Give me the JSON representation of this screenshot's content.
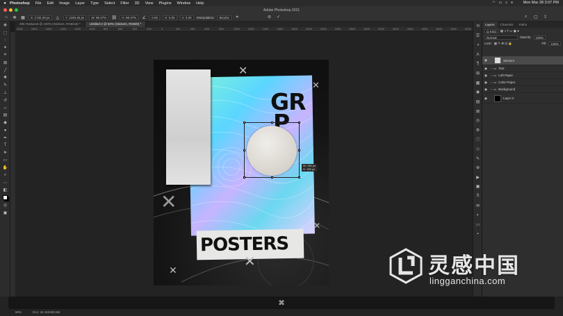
{
  "menubar": {
    "apple": "",
    "items": [
      "Photoshop",
      "File",
      "Edit",
      "Image",
      "Layer",
      "Type",
      "Select",
      "Filter",
      "3D",
      "View",
      "Plugins",
      "Window",
      "Help"
    ],
    "clock": "Mon Mar 28  3:07 PM"
  },
  "window": {
    "title": "Adobe Photoshop 2021"
  },
  "options": {
    "x": "X: 1732.29 px",
    "w": "W: 98.37%",
    "h": "H: 98.37%",
    "y": "Y: 1349.25 px",
    "angle": "0.00",
    "hskew": "H: 0.00",
    "vskew": "V: 0.00",
    "interp_label": "Interpolation:",
    "interp_value": "Bicubic"
  },
  "tabs": [
    {
      "label": "49K Reduced @ 100% (Stickers, RGB/16) *"
    },
    {
      "label": "Untitled-2 @ 50% (Stickers, RGB/8) *"
    }
  ],
  "ruler": [
    "2000",
    "1800",
    "1600",
    "1400",
    "1200",
    "1000",
    "800",
    "600",
    "400",
    "200",
    "0",
    "200",
    "400",
    "600",
    "800",
    "1000",
    "1200",
    "1400",
    "1600",
    "1800",
    "2000",
    "2200",
    "2400",
    "2600",
    "2800",
    "3000",
    "3200",
    "3400",
    "3600",
    "3800",
    "4000",
    "4200"
  ],
  "canvas": {
    "poster_headline": "GR",
    "poster_headline2": "P",
    "poster_footer": "POSTERS",
    "dim_w": "W: 783 px",
    "dim_h": "H: 783 px"
  },
  "layers_panel": {
    "tabs": [
      "Layers",
      "Channels",
      "Paths"
    ],
    "kind": "Q Kind",
    "blend": "Normal",
    "opacity_label": "Opacity:",
    "opacity": "100%",
    "lock_label": "Lock:",
    "fill_label": "Fill:",
    "fill": "100%",
    "layers": [
      {
        "name": "Stickers",
        "selected": true,
        "type": "layer"
      },
      {
        "name": "Text",
        "selected": false,
        "type": "group"
      },
      {
        "name": "Left Paper",
        "selected": false,
        "type": "group"
      },
      {
        "name": "Color Paper",
        "selected": false,
        "type": "group"
      },
      {
        "name": "Background",
        "selected": false,
        "type": "group"
      },
      {
        "name": "Layer 0",
        "selected": false,
        "type": "layer"
      }
    ]
  },
  "status": {
    "zoom": "50%",
    "doc": "Doc: 34.1M/483.6M"
  },
  "command_key": "⌘",
  "watermark": {
    "cn": "灵感中国",
    "url": "lingganchina.com"
  },
  "colors": {
    "accent": "#2e7bd6",
    "selected_layer": "#4a4a4a",
    "panel": "#2e2e2e"
  }
}
